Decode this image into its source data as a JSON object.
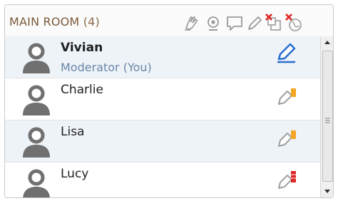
{
  "room": {
    "name": "MAIN ROOM",
    "count": "(4)"
  },
  "toolbar": {
    "icons": [
      "raise-hand-icon",
      "webcam-icon",
      "chat-icon",
      "pencil-icon",
      "disable-copy-icon",
      "disable-global-icon"
    ]
  },
  "participants": [
    {
      "name": "Vivian",
      "role": "Moderator (You)",
      "permission": "edit-blue",
      "accent": "#2a6fcf"
    },
    {
      "name": "Charlie",
      "role": "",
      "permission": "edit-orange",
      "accent": "#f5a623"
    },
    {
      "name": "Lisa",
      "role": "",
      "permission": "edit-orange",
      "accent": "#f5a623"
    },
    {
      "name": "Lucy",
      "role": "",
      "permission": "edit-red",
      "accent": "#e02424"
    }
  ],
  "colors": {
    "title": "#7a5b3a",
    "role": "#6a86a8",
    "alt_row": "#eef3f8"
  }
}
